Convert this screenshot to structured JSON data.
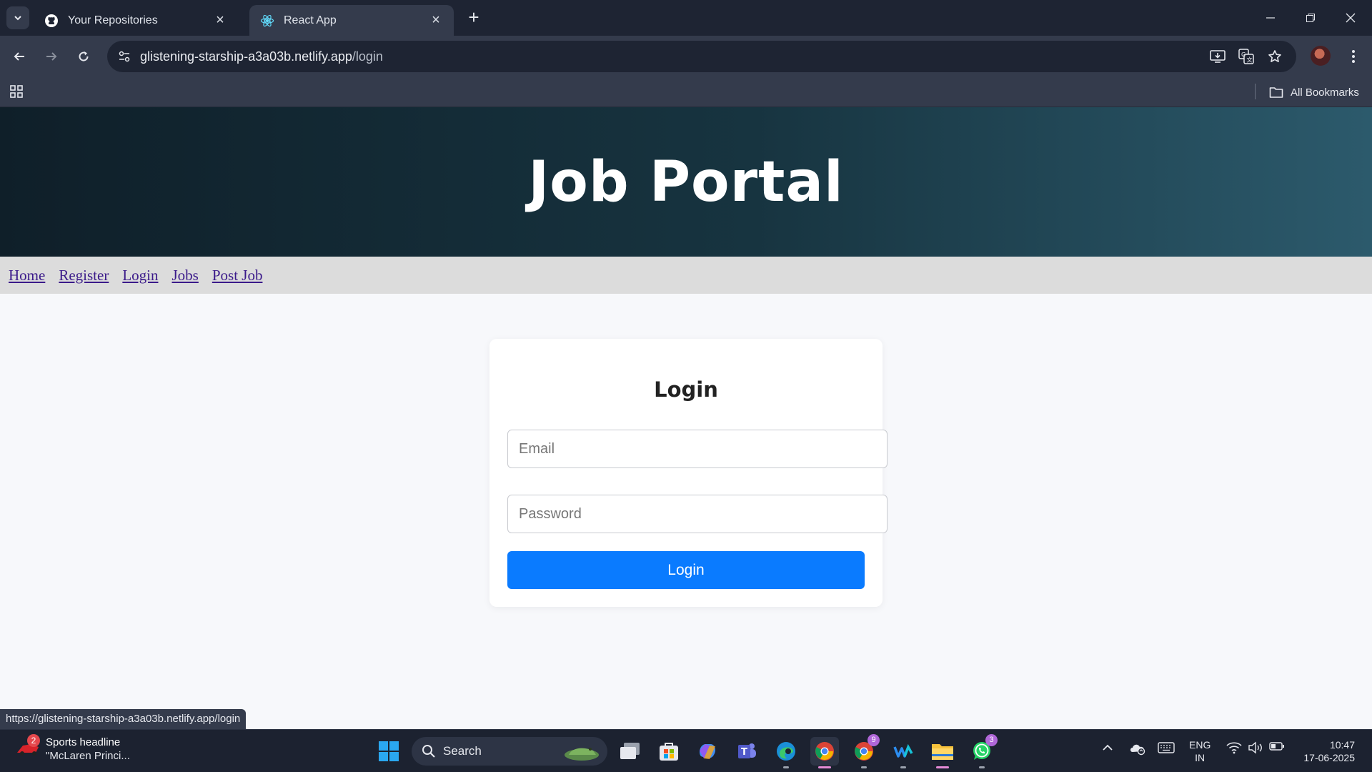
{
  "browser": {
    "tabs": [
      {
        "title": "Your Repositories",
        "favicon": "github-icon",
        "active": false
      },
      {
        "title": "React App",
        "favicon": "react-icon",
        "active": true
      }
    ],
    "address": {
      "host": "glistening-starship-a3a03b.netlify.app",
      "path": "/login"
    },
    "bookmarks_label": "All Bookmarks",
    "status_url": "https://glistening-starship-a3a03b.netlify.app/login"
  },
  "page": {
    "header_title": "Job Portal",
    "nav": [
      "Home",
      "Register",
      "Login",
      "Jobs",
      "Post Job"
    ],
    "form": {
      "title": "Login",
      "email_placeholder": "Email",
      "password_placeholder": "Password",
      "submit_label": "Login"
    },
    "colors": {
      "primary_button": "#0a7bff",
      "nav_link": "#3b1a8a",
      "header_dark": "#0f1f29",
      "header_light": "#2c5a6c"
    }
  },
  "taskbar": {
    "news": {
      "title": "Sports headline",
      "subtitle": "\"McLaren Princi...",
      "badge": "2"
    },
    "search_label": "Search",
    "badges": {
      "chrome_profile": "9",
      "whatsapp": "3"
    },
    "lang": {
      "line1": "ENG",
      "line2": "IN"
    },
    "clock": {
      "time": "10:47",
      "date": "17-06-2025"
    }
  }
}
